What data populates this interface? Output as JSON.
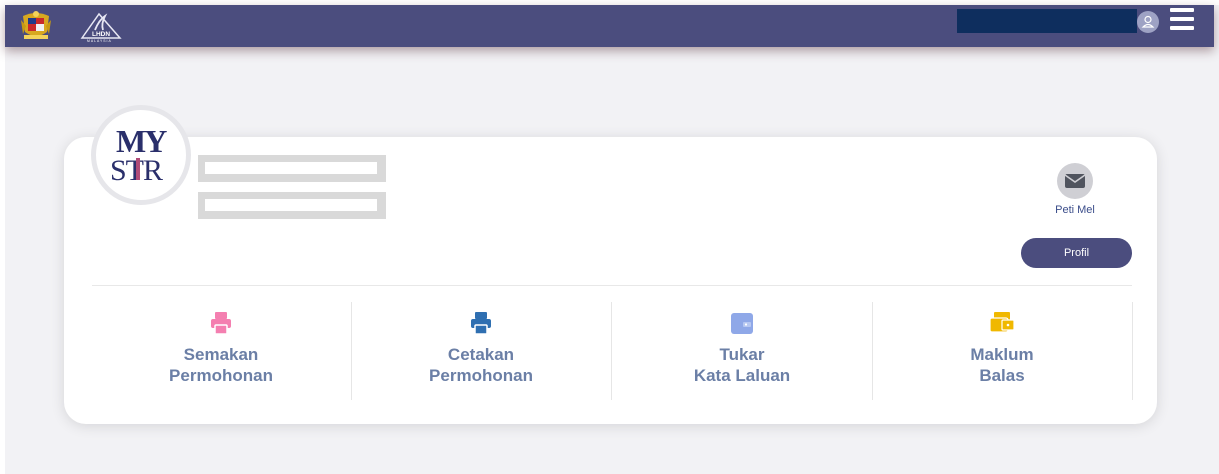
{
  "header": {
    "crest_icon": "malaysia-crest-icon",
    "brand_logo": "lhdn-logo",
    "brand_text": "LHDN",
    "brand_subtext": "MALAYSIA",
    "navbar_color": "#4b4d7e"
  },
  "profile": {
    "logo": {
      "line1": "MY",
      "line2": "STR"
    },
    "mail_label": "Peti Mel",
    "profile_button": "Profil"
  },
  "menu": [
    {
      "line1": "Semakan",
      "line2": "Permohonan",
      "icon": "print-icon",
      "color": "#f47fb0"
    },
    {
      "line1": "Cetakan",
      "line2": "Permohonan",
      "icon": "print-icon",
      "color": "#2f6fb1"
    },
    {
      "line1": "Tukar",
      "line2": "Kata Laluan",
      "icon": "wallet-icon",
      "color": "#8fa8e8"
    },
    {
      "line1": "Maklum",
      "line2": "Balas",
      "icon": "feedback-icon",
      "color": "#f0b800"
    }
  ]
}
